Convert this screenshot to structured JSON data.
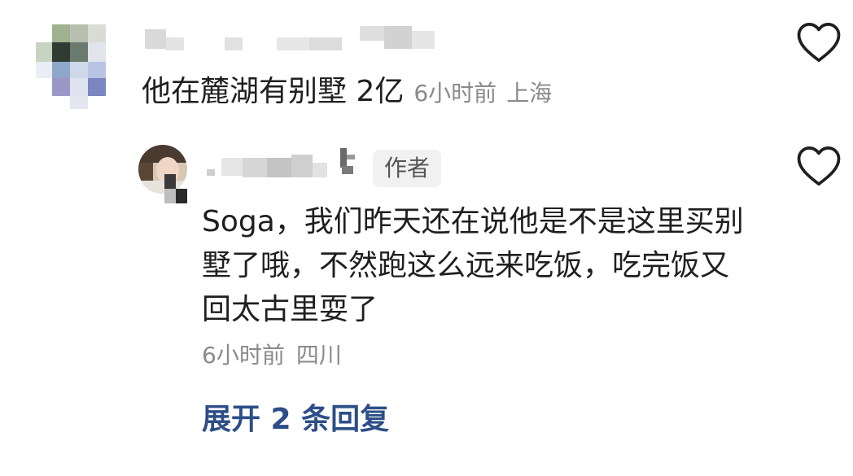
{
  "comments": [
    {
      "text": "他在麓湖有别墅 2亿",
      "time": "6小时前",
      "location": "上海"
    }
  ],
  "reply": {
    "badge": "作者",
    "text": "Soga，我们昨天还在说他是不是这里买别墅了哦，不然跑这么远来吃饭，吃完饭又回太古里耍了",
    "time": "6小时前",
    "location": "四川"
  },
  "expand_label": "展开 2 条回复",
  "icons": {
    "like": "heart-outline-icon",
    "avatar": "avatar-icon"
  },
  "colors": {
    "text": "#1f1f1f",
    "meta": "#8a8a8a",
    "link": "#2d4e86",
    "badge_bg": "#f1f1f1"
  }
}
